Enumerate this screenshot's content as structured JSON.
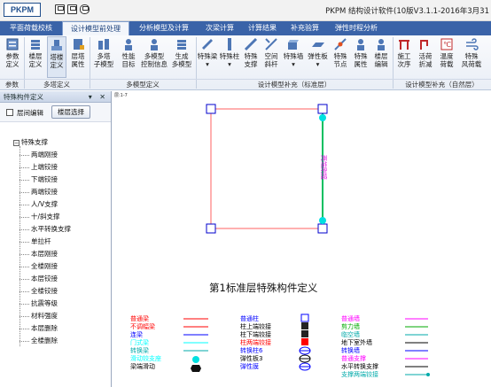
{
  "app": {
    "logo": "PKPM",
    "title": "PKPM 结构设计软件(10版V3.1.1-2016年3月31"
  },
  "tabs": [
    {
      "label": "平面荷载校核",
      "active": false
    },
    {
      "label": "设计模型前处理",
      "active": true
    },
    {
      "label": "分析模型及计算",
      "active": false
    },
    {
      "label": "次梁计算",
      "active": false
    },
    {
      "label": "计算结果",
      "active": false
    },
    {
      "label": "补充验算",
      "active": false
    },
    {
      "label": "弹性时程分析",
      "active": false
    }
  ],
  "ribbon": {
    "buttons": [
      {
        "line1": "参数",
        "line2": "定义",
        "icon": "parameters-icon"
      },
      {
        "line1": "楼层",
        "line2": "定义",
        "icon": "floor-define-icon"
      },
      {
        "line1": "塔楼",
        "line2": "定义",
        "icon": "tower-define-icon"
      },
      {
        "line1": "层塔",
        "line2": "属性",
        "icon": "layer-tower-property-icon"
      },
      {
        "line1": "多塔",
        "line2": "子模型",
        "icon": "multi-tower-submodel-icon"
      },
      {
        "line1": "性能",
        "line2": "目标",
        "icon": "performance-target-icon"
      },
      {
        "line1": "多模型",
        "line2": "控制信息",
        "icon": "multi-model-control-icon"
      },
      {
        "line1": "生成",
        "line2": "多模型",
        "icon": "generate-multi-model-icon"
      },
      {
        "line1": "特殊梁",
        "line2": "▾",
        "icon": "special-beam-icon"
      },
      {
        "line1": "特殊柱",
        "line2": "▾",
        "icon": "special-column-icon"
      },
      {
        "line1": "特殊",
        "line2": "支撑",
        "icon": "special-brace-icon"
      },
      {
        "line1": "空间",
        "line2": "斜杆",
        "icon": "space-diagonal-icon"
      },
      {
        "line1": "特殊墙",
        "line2": "▾",
        "icon": "special-wall-icon"
      },
      {
        "line1": "弹性板",
        "line2": "▾",
        "icon": "elastic-slab-icon"
      },
      {
        "line1": "特殊",
        "line2": "节点",
        "icon": "special-node-icon"
      },
      {
        "line1": "特殊",
        "line2": "属性",
        "icon": "special-property-icon"
      },
      {
        "line1": "楼层",
        "line2": "编辑",
        "icon": "floor-edit-icon"
      },
      {
        "line1": "施工",
        "line2": "次序",
        "icon": "construction-order-icon"
      },
      {
        "line1": "活荷",
        "line2": "折减",
        "icon": "live-load-reduction-icon"
      },
      {
        "line1": "温度",
        "line2": "荷载",
        "icon": "temperature-load-icon"
      },
      {
        "line1": "特殊",
        "line2": "风荷载",
        "icon": "special-wind-load-icon"
      }
    ],
    "groups": [
      "参数",
      "多塔定义",
      "多模型定义",
      "设计模型补充（标准层）",
      "设计模型补充（自然层）"
    ]
  },
  "left_panel": {
    "title": "特殊构件定义",
    "controls": "▾ ✕",
    "checkbox_label": "层间编辑",
    "button_label": "楼层选择",
    "tree_root": "特殊支撑",
    "tree_items": [
      "两端刚接",
      "上端铰接",
      "下端铰接",
      "两端铰接",
      "人/V支撑",
      "十/斜支撑",
      "水平转换支撑",
      "单拉杆",
      "本层刚接",
      "全楼刚接",
      "本层铰接",
      "全楼铰接",
      "抗震等级",
      "材料强度",
      "本层删除",
      "全楼删除"
    ]
  },
  "canvas": {
    "view_label": "层:1-7",
    "member_label": "两端刚接",
    "title": "第1标准层特殊构件定义",
    "legend": [
      {
        "text": "普通梁",
        "color": "#ff0000"
      },
      {
        "text": "不调幅梁",
        "color": "#ff0000"
      },
      {
        "text": "连梁",
        "color": "#0000ff"
      },
      {
        "text": "门式梁",
        "color": "#00ffff"
      },
      {
        "text": "转换梁",
        "color": "#00aaaa"
      },
      {
        "text": "滑动铰支座",
        "color": "#00ffff"
      },
      {
        "text": "梁端滑动",
        "color": "#000000"
      },
      {
        "text": "普通柱",
        "color": "#0000ff"
      },
      {
        "text": "柱上端铰接",
        "color": "#000000"
      },
      {
        "text": "柱下端铰接",
        "color": "#000000"
      },
      {
        "text": "柱两端铰接",
        "color": "#ff0000"
      },
      {
        "text": "转换柱6",
        "color": "#0000ff"
      },
      {
        "text": "弹性板3",
        "color": "#000000"
      },
      {
        "text": "弹性膜",
        "color": "#0000ff"
      },
      {
        "text": "普通墙",
        "color": "#ff00ff"
      },
      {
        "text": "剪力墙",
        "color": "#00aa00"
      },
      {
        "text": "临空墙",
        "color": "#00aaaa"
      },
      {
        "text": "地下室外墙",
        "color": "#000000"
      },
      {
        "text": "转换墙",
        "color": "#0000ff"
      },
      {
        "text": "普通支撑",
        "color": "#ff00ff"
      },
      {
        "text": "水平转换支撑",
        "color": "#000000"
      },
      {
        "text": "支撑两端铰接",
        "color": "#00aaaa"
      }
    ]
  }
}
